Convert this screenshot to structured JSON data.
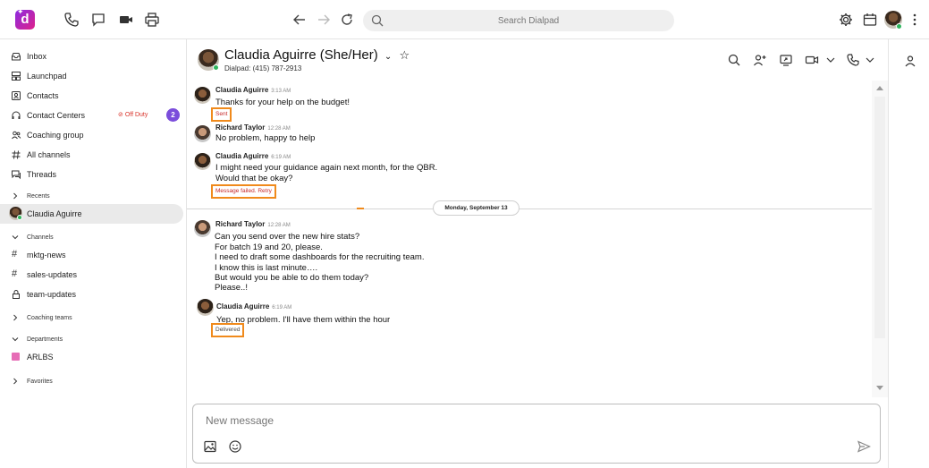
{
  "app": {
    "name": "Dialpad",
    "accent": "#7b4ddb",
    "status_outline": "#f08a1c"
  },
  "topbar": {
    "logo_letter": "d",
    "icons": [
      "phone-icon",
      "chat-icon",
      "video-icon",
      "print-icon",
      "back-arrow-icon",
      "forward-arrow-icon",
      "refresh-icon",
      "settings-icon",
      "calendar-icon",
      "kebab-menu-icon"
    ],
    "search_placeholder": "Search Dialpad"
  },
  "sidebar": {
    "items": [
      {
        "label": "Inbox",
        "icon": "inbox-icon"
      },
      {
        "label": "Launchpad",
        "icon": "launchpad-icon"
      },
      {
        "label": "Contacts",
        "icon": "contacts-icon"
      },
      {
        "label": "Contact Centers",
        "icon": "headset-icon",
        "status": "Off Duty",
        "badge": "2"
      },
      {
        "label": "Coaching group",
        "icon": "people-icon"
      },
      {
        "label": "All channels",
        "icon": "hash-icon"
      },
      {
        "label": "Threads",
        "icon": "threads-icon"
      }
    ],
    "recents_label": "Recents",
    "recents": [
      {
        "label": "Claudia Aguirre"
      }
    ],
    "channels_label": "Channels",
    "channels": [
      {
        "label": "mktg-news",
        "icon": "#"
      },
      {
        "label": "sales-updates",
        "icon": "#"
      },
      {
        "label": "team-updates",
        "icon": "lock"
      }
    ],
    "coaching_teams_label": "Coaching teams",
    "departments_label": "Departments",
    "departments": [
      {
        "label": "ARLBS",
        "color": "#e66db6"
      }
    ],
    "favorites_label": "Favorites"
  },
  "conversation": {
    "name": "Claudia Aguirre (She/Her)",
    "subtitle": "Dialpad: (415) 787-2913",
    "date_divider": "Monday, September 13",
    "messages": [
      {
        "sender": "Claudia Aguirre",
        "time": "3:13 AM",
        "lines": [
          "Thanks for your help on the budget!"
        ],
        "status": "Sent"
      },
      {
        "sender": "Richard Taylor",
        "time": "12:28 AM",
        "lines": [
          "No problem, happy to help"
        ]
      },
      {
        "sender": "Claudia Aguirre",
        "time": "6:19 AM",
        "lines": [
          "I might need your guidance again next month, for the QBR.",
          "Would that be okay?"
        ],
        "status": "Message failed. Retry"
      },
      {
        "sender": "Richard Taylor",
        "time": "12:28 AM",
        "lines": [
          "Can you send over the new hire stats?",
          "For batch 19 and 20, please.",
          "I need to draft some dashboards for the recruiting team.",
          "I know this is last minute….",
          "But would you be able to do them today?",
          "Please..!"
        ]
      },
      {
        "sender": "Claudia Aguirre",
        "time": "6:19 AM",
        "lines": [
          "Yep, no problem. I'll have them within the hour"
        ],
        "status": "Delivered"
      }
    ]
  },
  "composer": {
    "placeholder": "New message"
  }
}
